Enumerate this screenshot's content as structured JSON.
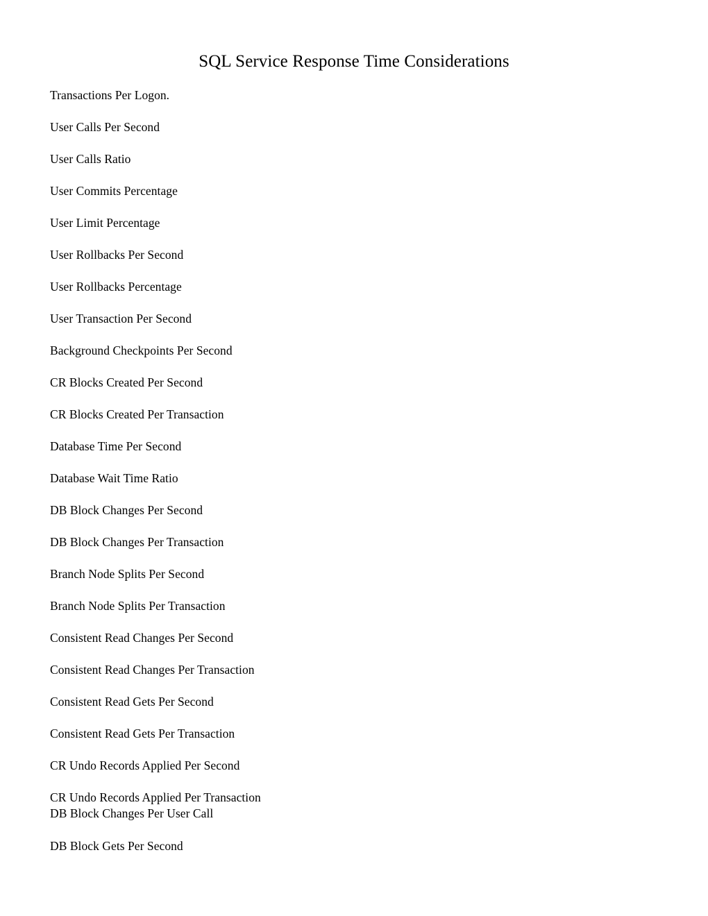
{
  "document": {
    "title": "SQL Service Response Time Considerations",
    "page_background": "#ffffff",
    "text_color": "#000000",
    "items": [
      {
        "text": "Transactions Per Logon."
      },
      {
        "text": "User Calls Per Second"
      },
      {
        "text": "User Calls Ratio"
      },
      {
        "text": "User Commits Percentage"
      },
      {
        "text": "User Limit Percentage"
      },
      {
        "text": "User Rollbacks Per Second"
      },
      {
        "text": "User Rollbacks Percentage"
      },
      {
        "text": "User Transaction Per Second"
      },
      {
        "text": "Background Checkpoints Per Second"
      },
      {
        "text": "CR Blocks Created Per Second"
      },
      {
        "text": "CR Blocks Created Per Transaction"
      },
      {
        "text": "Database Time Per Second"
      },
      {
        "text": "Database Wait Time Ratio"
      },
      {
        "text": "DB Block Changes Per Second"
      },
      {
        "text": "DB Block Changes Per Transaction"
      },
      {
        "text": "Branch Node Splits Per Second"
      },
      {
        "text": "Branch Node Splits Per Transaction"
      },
      {
        "text": "Consistent Read Changes Per Second"
      },
      {
        "text": "Consistent Read Changes Per Transaction"
      },
      {
        "text": "Consistent Read Gets Per Second"
      },
      {
        "text": "Consistent Read Gets Per Transaction"
      },
      {
        "text": "CR Undo Records Applied Per Second"
      },
      {
        "text": "CR Undo Records Applied Per Transaction",
        "continuation": "DB Block Changes Per User Call"
      },
      {
        "text": "DB Block Gets Per Second"
      }
    ]
  }
}
